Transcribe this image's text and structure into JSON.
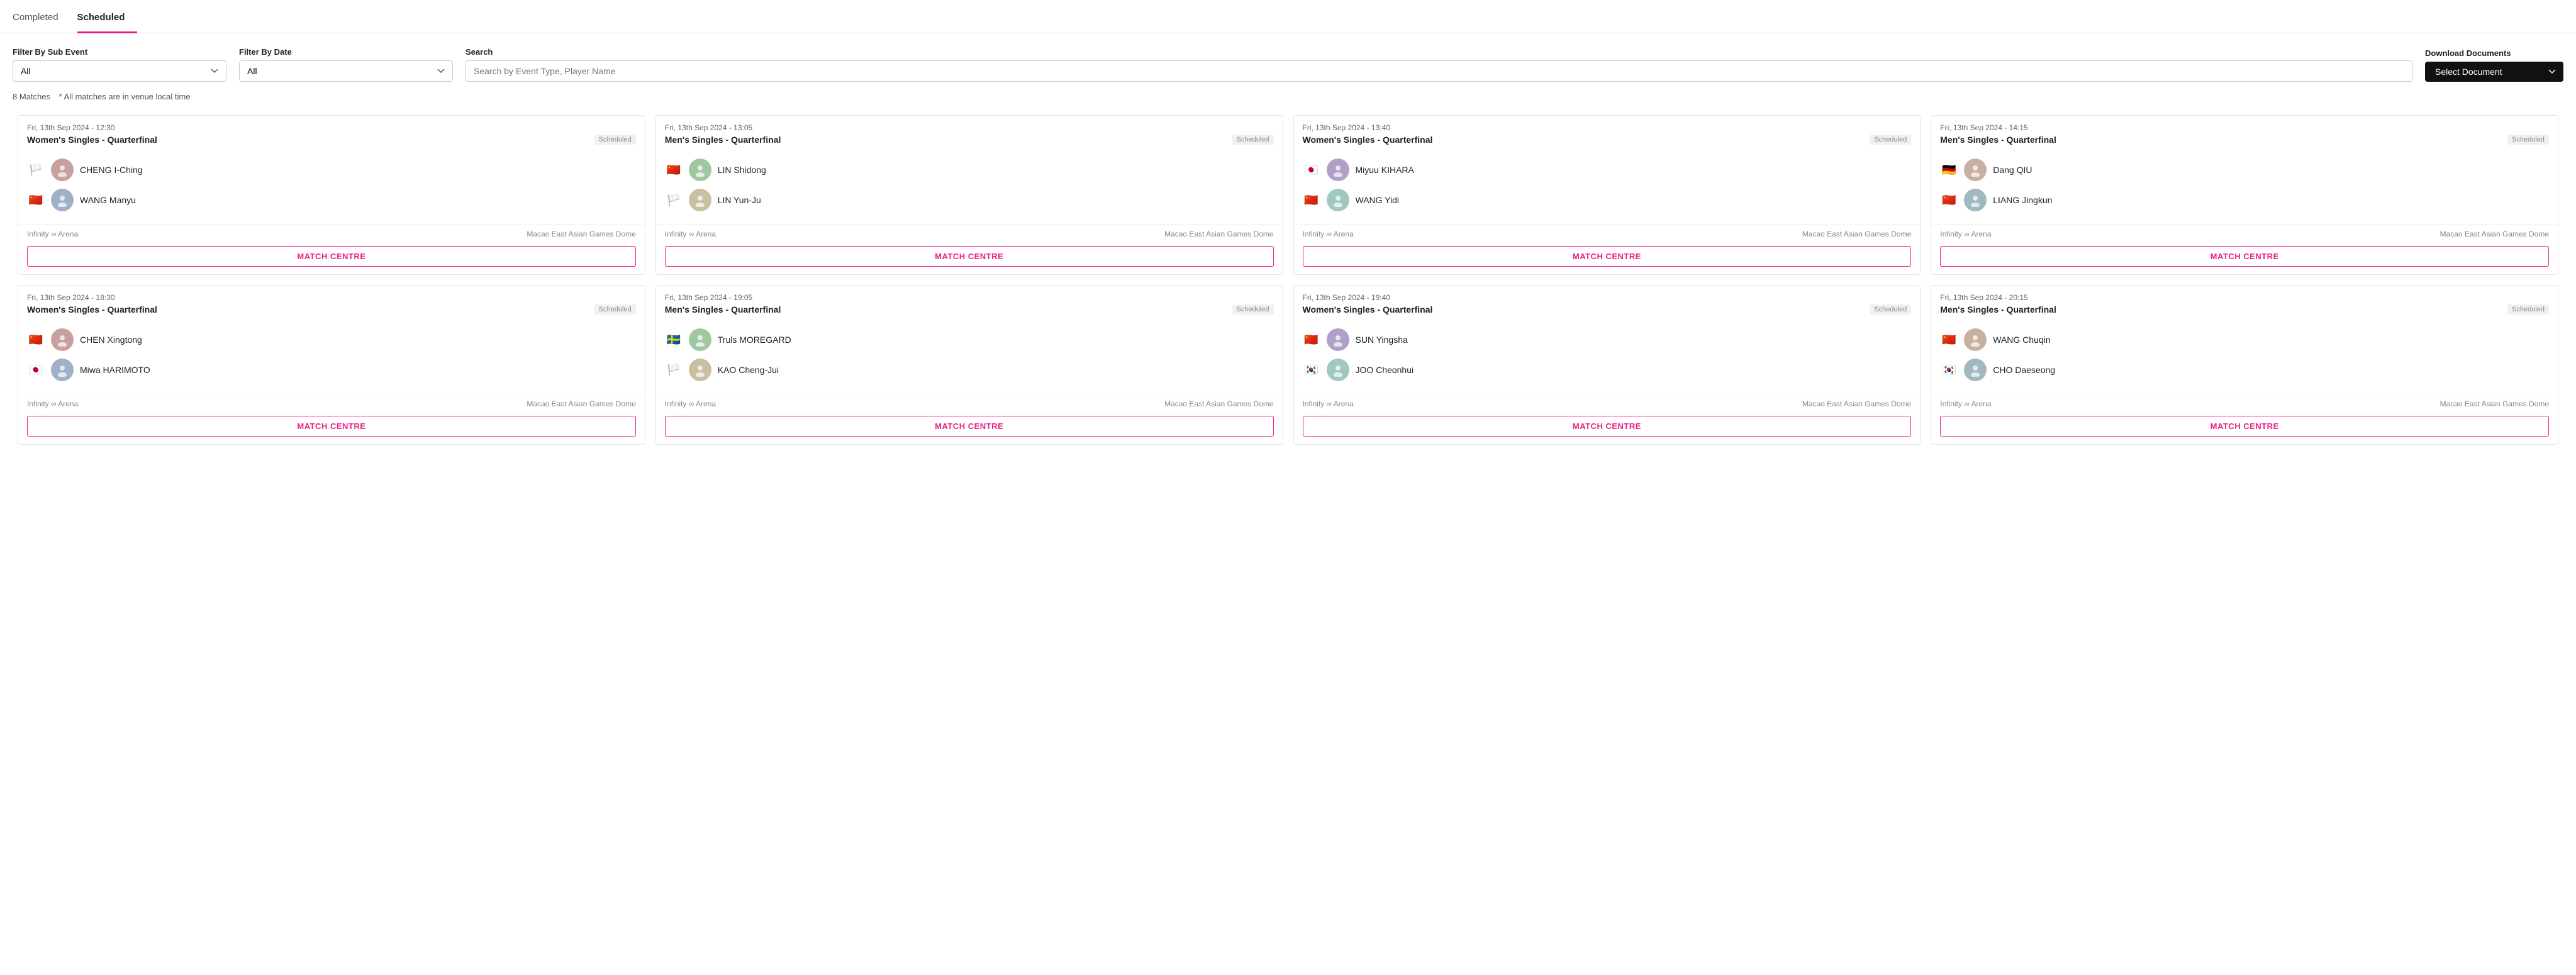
{
  "tabs": [
    {
      "id": "completed",
      "label": "Completed",
      "active": false
    },
    {
      "id": "scheduled",
      "label": "Scheduled",
      "active": true
    }
  ],
  "filters": {
    "sub_event_label": "Filter By Sub Event",
    "sub_event_value": "All",
    "date_label": "Filter By Date",
    "date_value": "All",
    "search_label": "Search",
    "search_placeholder": "Search by Event Type, Player Name",
    "download_label": "Download Documents",
    "download_btn": "Select Document"
  },
  "matches_info": {
    "count": "8 Matches",
    "note": "* All matches are in venue local time"
  },
  "matches": [
    {
      "id": 1,
      "datetime": "Fri, 13th Sep 2024 - 12:30",
      "event": "Women's Singles - Quarterfinal",
      "status": "Scheduled",
      "players": [
        {
          "flag": "🏳️",
          "flag_type": "taiwan",
          "name": "CHENG I-Ching",
          "avatar": "👤"
        },
        {
          "flag": "🇨🇳",
          "flag_type": "china",
          "name": "WANG Manyu",
          "avatar": "👤"
        }
      ],
      "venue": "Infinity ∞ Arena",
      "location": "Macao East Asian Games Dome",
      "match_centre": "MATCH CENTRE"
    },
    {
      "id": 2,
      "datetime": "Fri, 13th Sep 2024 - 13:05",
      "event": "Men's Singles - Quarterfinal",
      "status": "Scheduled",
      "players": [
        {
          "flag": "🇨🇳",
          "flag_type": "china",
          "name": "LIN Shidong",
          "avatar": "👤"
        },
        {
          "flag": "🏳️",
          "flag_type": "taiwan",
          "name": "LIN Yun-Ju",
          "avatar": "👤"
        }
      ],
      "venue": "Infinity ∞ Arena",
      "location": "Macao East Asian Games Dome",
      "match_centre": "MATCH CENTRE"
    },
    {
      "id": 3,
      "datetime": "Fri, 13th Sep 2024 - 13:40",
      "event": "Women's Singles - Quarterfinal",
      "status": "Scheduled",
      "players": [
        {
          "flag": "🇯🇵",
          "flag_type": "japan",
          "name": "Miyuu KIHARA",
          "avatar": "👤"
        },
        {
          "flag": "🇨🇳",
          "flag_type": "china",
          "name": "WANG Yidi",
          "avatar": "👤"
        }
      ],
      "venue": "Infinity ∞ Arena",
      "location": "Macao East Asian Games Dome",
      "match_centre": "MATCH CENTRE"
    },
    {
      "id": 4,
      "datetime": "Fri, 13th Sep 2024 - 14:15",
      "event": "Men's Singles - Quarterfinal",
      "status": "Scheduled",
      "players": [
        {
          "flag": "🇩🇪",
          "flag_type": "germany",
          "name": "Dang QIU",
          "avatar": "👤"
        },
        {
          "flag": "🇨🇳",
          "flag_type": "china",
          "name": "LIANG Jingkun",
          "avatar": "👤"
        }
      ],
      "venue": "Infinity ∞ Arena",
      "location": "Macao East Asian Games Dome",
      "match_centre": "MATCH CENTRE"
    },
    {
      "id": 5,
      "datetime": "Fri, 13th Sep 2024 - 18:30",
      "event": "Women's Singles - Quarterfinal",
      "status": "Scheduled",
      "players": [
        {
          "flag": "🇨🇳",
          "flag_type": "china",
          "name": "CHEN Xingtong",
          "avatar": "👤"
        },
        {
          "flag": "🇯🇵",
          "flag_type": "japan",
          "name": "Miwa HARIMOTO",
          "avatar": "👤"
        }
      ],
      "venue": "Infinity ∞ Arena",
      "location": "Macao East Asian Games Dome",
      "match_centre": "MATCH CENTRE"
    },
    {
      "id": 6,
      "datetime": "Fri, 13th Sep 2024 - 19:05",
      "event": "Men's Singles - Quarterfinal",
      "status": "Scheduled",
      "players": [
        {
          "flag": "🇸🇪",
          "flag_type": "sweden",
          "name": "Truls MOREGARD",
          "avatar": "👤"
        },
        {
          "flag": "🏳️",
          "flag_type": "taiwan",
          "name": "KAO Cheng-Jui",
          "avatar": "👤"
        }
      ],
      "venue": "Infinity ∞ Arena",
      "location": "Macao East Asian Games Dome",
      "match_centre": "MATCH CENTRE"
    },
    {
      "id": 7,
      "datetime": "Fri, 13th Sep 2024 - 19:40",
      "event": "Women's Singles - Quarterfinal",
      "status": "Scheduled",
      "players": [
        {
          "flag": "🇨🇳",
          "flag_type": "china",
          "name": "SUN Yingsha",
          "avatar": "👤"
        },
        {
          "flag": "🇰🇷",
          "flag_type": "korea",
          "name": "JOO Cheonhui",
          "avatar": "👤"
        }
      ],
      "venue": "Infinity ∞ Arena",
      "location": "Macao East Asian Games Dome",
      "match_centre": "MATCH CENTRE"
    },
    {
      "id": 8,
      "datetime": "Fri, 13th Sep 2024 - 20:15",
      "event": "Men's Singles - Quarterfinal",
      "status": "Scheduled",
      "players": [
        {
          "flag": "🇨🇳",
          "flag_type": "china",
          "name": "WANG Chuqin",
          "avatar": "👤"
        },
        {
          "flag": "🇰🇷",
          "flag_type": "korea",
          "name": "CHO Daeseong",
          "avatar": "👤"
        }
      ],
      "venue": "Infinity ∞ Arena",
      "location": "Macao East Asian Games Dome",
      "match_centre": "MATCH CENTRE"
    }
  ]
}
